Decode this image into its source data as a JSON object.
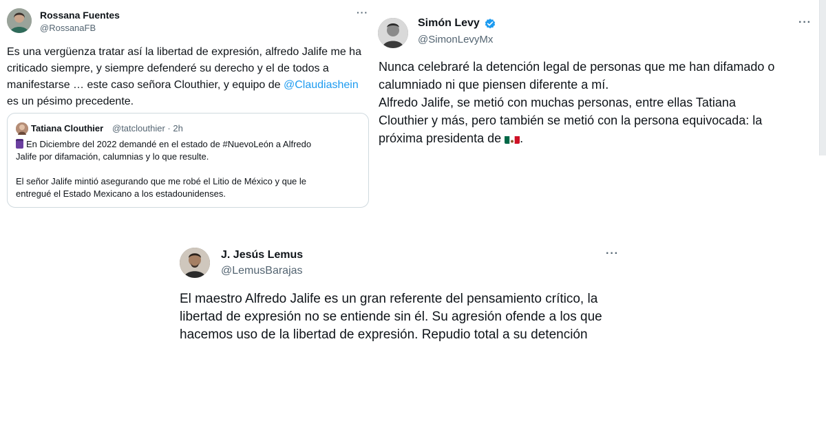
{
  "tweets": [
    {
      "name": "Rossana Fuentes",
      "handle": "@RossanaFB",
      "more": "···",
      "text": {
        "line1": "Es una vergüenza tratar así la libertad de expresión, alfredo Jalife me ha",
        "line2": "criticado siempre, y siempre defenderé su derecho y el de todos a",
        "line3_prefix": "manifestarse … este caso señora Clouthier, y equipo de ",
        "line3_mention": "@Claudiashein",
        "line4": "es un pésimo precedente."
      },
      "quote": {
        "name": "Tatiana Clouthier",
        "handle": "@tatclouthier · 2h",
        "line1": "En Diciembre del 2022 demandé en el estado de #NuevoLeón a Alfredo",
        "line2": "Jalife por difamación, calumnias y lo que resulte.",
        "line3": "El señor Jalife mintió asegurando que me robé el Litio de México y que le",
        "line4": "entregué el Estado Mexicano a los estadounidenses.",
        "icon": "calendar-icon"
      }
    },
    {
      "name": "Simón Levy",
      "handle": "@SimonLevyMx",
      "more": "···",
      "verified_icon": "verified-badge-icon",
      "accent": "#1d9bf0",
      "text": {
        "line1": "Nunca celebraré la detención legal de personas que me han difamado o",
        "line2": "calumniado ni que piensen diferente a mí.",
        "line3": "Alfredo Jalife, se metió con muchas personas, entre ellas Tatiana",
        "line4": "Clouthier y más, pero también se metió con la persona equivocada: la",
        "line5_prefix": "próxima presidenta de ",
        "line5_suffix": ".",
        "flag_icon": "mexico-flag-icon"
      }
    },
    {
      "name": "J. Jesús Lemus",
      "handle": "@LemusBarajas",
      "more": "···",
      "text": {
        "line1": "El maestro Alfredo Jalife es un gran referente del pensamiento crítico, la",
        "line2": "libertad de expresión no se entiende sin él. Su agresión ofende a los que",
        "line3": "hacemos uso de la libertad de expresión. Repudio total a su detención"
      }
    }
  ]
}
